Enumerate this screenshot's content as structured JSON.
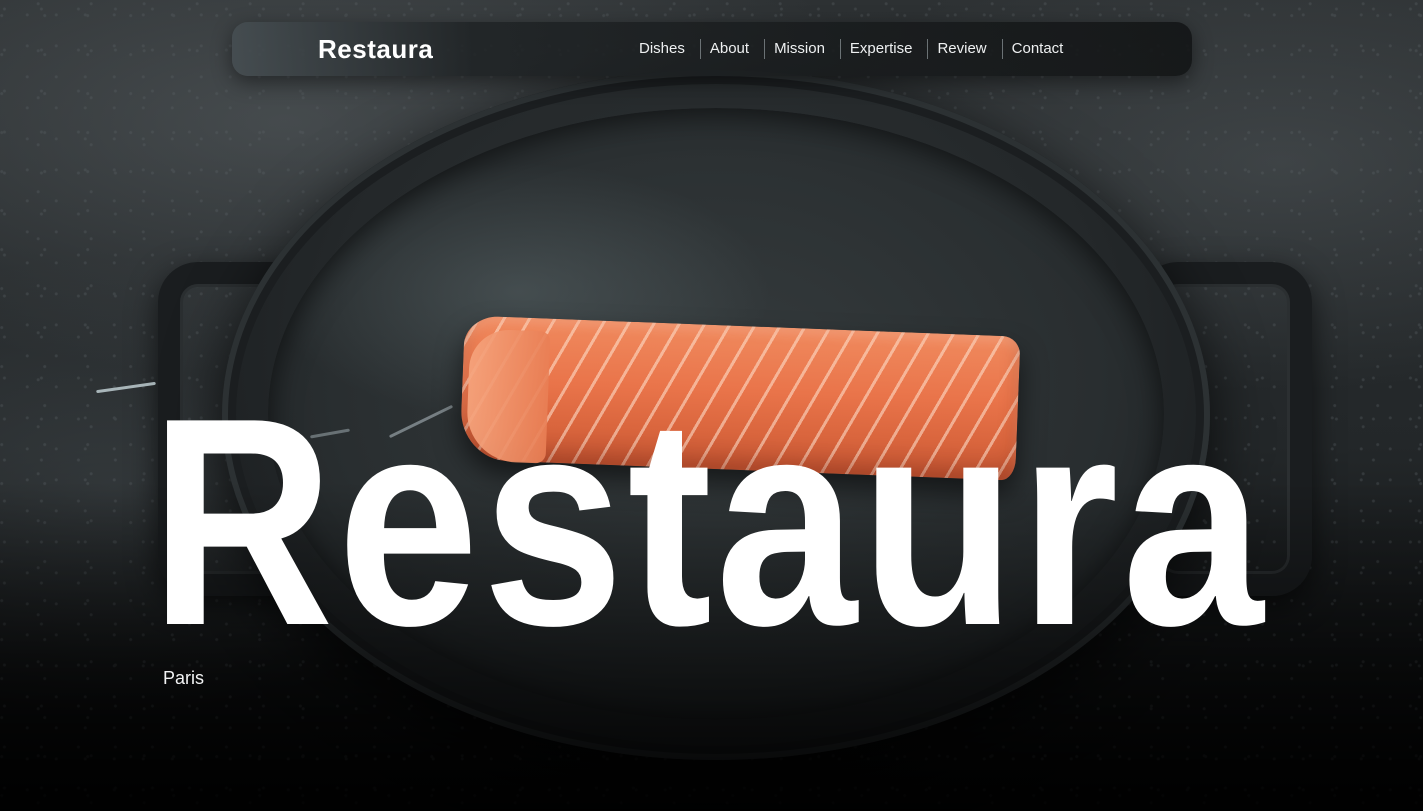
{
  "header": {
    "brand": "Restaura",
    "nav": [
      {
        "label": "Dishes"
      },
      {
        "label": "About"
      },
      {
        "label": "Mission"
      },
      {
        "label": "Expertise"
      },
      {
        "label": "Review"
      },
      {
        "label": "Contact"
      }
    ]
  },
  "hero": {
    "title": "Restaura",
    "location": "Paris",
    "image_subject": "salmon-fillet-on-cast-iron-pan"
  },
  "colors": {
    "text": "#ffffff",
    "salmon": "#e9744a",
    "background": "#232729"
  }
}
